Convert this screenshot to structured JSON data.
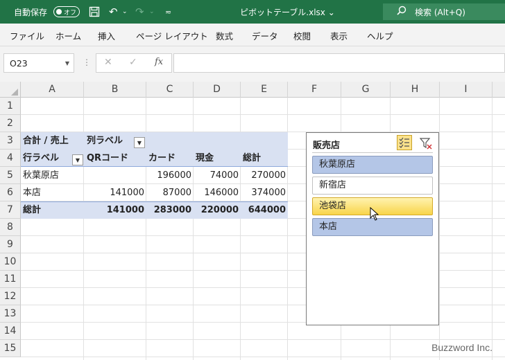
{
  "titlebar": {
    "autosave_label": "自動保存",
    "autosave_state": "オフ",
    "doc_title": "ピボットテーブル.xlsx ⌄",
    "search_text": "検索 (Alt+Q)"
  },
  "menu": [
    "ファイル",
    "ホーム",
    "挿入",
    "ページ レイアウト",
    "数式",
    "データ",
    "校閲",
    "表示",
    "ヘルプ"
  ],
  "formula": {
    "cell_ref": "O23",
    "value": ""
  },
  "grid": {
    "columns": [
      "A",
      "B",
      "C",
      "D",
      "E",
      "F",
      "G",
      "H",
      "I"
    ],
    "rows": [
      "1",
      "2",
      "3",
      "4",
      "5",
      "6",
      "7",
      "8",
      "9",
      "10",
      "11",
      "12",
      "13",
      "14",
      "15"
    ]
  },
  "pivot": {
    "value_label": "合計 / 売上",
    "col_label": "列ラベル",
    "row_label": "行ラベル",
    "headers": [
      "QRコード",
      "カード",
      "現金",
      "総計"
    ],
    "rows": [
      {
        "name": "秋葉原店",
        "values": [
          "",
          "196000",
          "74000",
          "270000"
        ]
      },
      {
        "name": "本店",
        "values": [
          "141000",
          "87000",
          "146000",
          "374000"
        ]
      }
    ],
    "total": {
      "name": "総計",
      "values": [
        "141000",
        "283000",
        "220000",
        "644000"
      ]
    }
  },
  "slicer": {
    "title": "販売店",
    "items": [
      {
        "label": "秋葉原店",
        "state": "selected"
      },
      {
        "label": "新宿店",
        "state": "unselected"
      },
      {
        "label": "池袋店",
        "state": "hover"
      },
      {
        "label": "本店",
        "state": "selected"
      }
    ]
  },
  "watermark": "Buzzword Inc.",
  "colors": {
    "excel_green": "#217346",
    "pivot_header": "#d9e1f2",
    "slicer_selected": "#b4c6e7",
    "slicer_hover": "#f8d44a"
  }
}
